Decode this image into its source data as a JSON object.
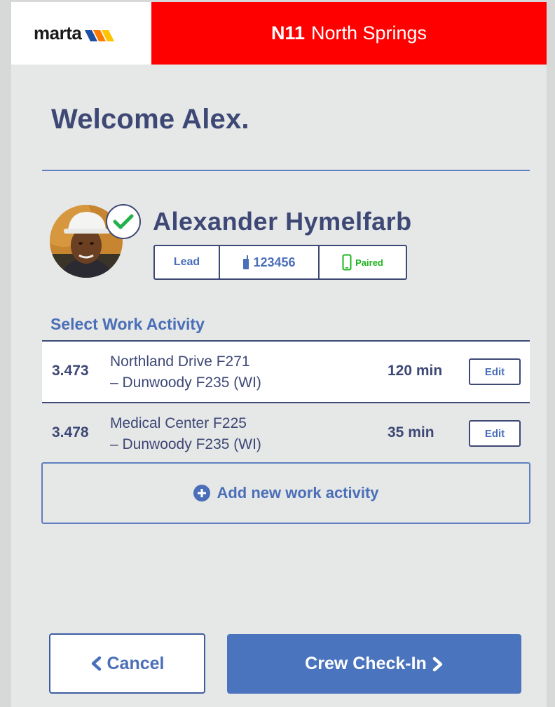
{
  "header": {
    "logo_text": "marta",
    "station_code": "N11",
    "station_name": "North Springs"
  },
  "welcome": "Welcome Alex.",
  "user": {
    "name": "Alexander Hymelfarb",
    "role": "Lead",
    "radio_id": "123456",
    "device_status": "Paired"
  },
  "activities": {
    "title": "Select Work Activity",
    "items": [
      {
        "id": "3.473",
        "line1": "Northland Drive F271",
        "line2": "– Dunwoody F235 (WI)",
        "duration": "120 min",
        "edit_label": "Edit"
      },
      {
        "id": "3.478",
        "line1": "Medical Center F225",
        "line2": "– Dunwoody F235 (WI)",
        "duration": "35 min",
        "edit_label": "Edit"
      }
    ],
    "add_label": "Add new work activity"
  },
  "footer": {
    "cancel_label": "Cancel",
    "checkin_label": "Crew Check-In"
  },
  "colors": {
    "brand_red": "#ff0000",
    "navy": "#3d4875",
    "accent_blue": "#4a74be",
    "paired_green": "#1db41d"
  }
}
